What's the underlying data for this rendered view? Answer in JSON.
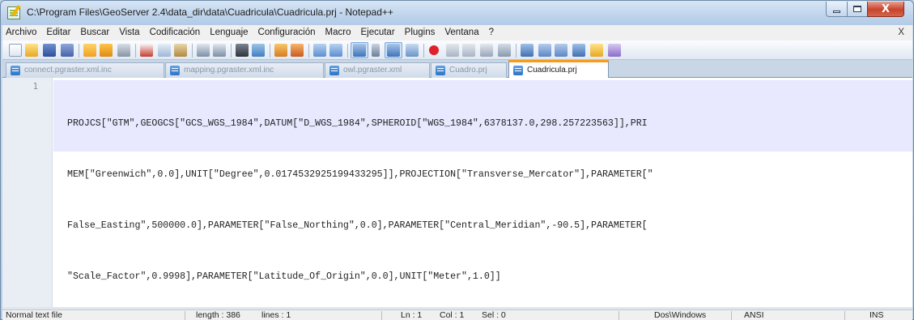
{
  "window": {
    "title": "C:\\Program Files\\GeoServer 2.4\\data_dir\\data\\Cuadricula\\Cuadricula.prj - Notepad++",
    "close_glyph": "X"
  },
  "menu": {
    "items": [
      "Archivo",
      "Editar",
      "Buscar",
      "Vista",
      "Codificación",
      "Lenguaje",
      "Configuración",
      "Macro",
      "Ejecutar",
      "Plugins",
      "Ventana",
      "?"
    ],
    "close_label": "X"
  },
  "toolbar": {
    "icons": [
      "new-file-icon",
      "open-file-icon",
      "save-icon",
      "save-all-icon",
      "close-icon",
      "close-all-icon",
      "print-icon",
      "cut-icon",
      "copy-icon",
      "paste-icon",
      "undo-icon",
      "redo-icon",
      "find-icon",
      "replace-icon",
      "zoom-in-icon",
      "zoom-out-icon",
      "sync-vertical-icon",
      "sync-horizontal-icon",
      "word-wrap-icon",
      "show-all-chars-icon",
      "indent-guide-icon",
      "doc-map-icon",
      "record-macro-icon",
      "stop-record-icon",
      "play-macro-icon",
      "run-macro-multiple-icon",
      "save-macro-icon",
      "spellcheck-icon",
      "nav-up-icon",
      "nav-down-icon",
      "plugin-icon",
      "folder-icon",
      "spell-icon"
    ]
  },
  "tabs": [
    {
      "label": "connect.pgraster.xml.inc",
      "active": false
    },
    {
      "label": "mapping.pgraster.xml.inc",
      "active": false
    },
    {
      "label": "owl.pgraster.xml",
      "active": false
    },
    {
      "label": "Cuadro.prj",
      "active": false
    },
    {
      "label": "Cuadricula.prj",
      "active": true
    }
  ],
  "editor": {
    "line_number": "1",
    "lines": [
      "PROJCS[\"GTM\",GEOGCS[\"GCS_WGS_1984\",DATUM[\"D_WGS_1984\",SPHEROID[\"WGS_1984\",6378137.0,298.257223563]],PRI",
      "MEM[\"Greenwich\",0.0],UNIT[\"Degree\",0.0174532925199433295]],PROJECTION[\"Transverse_Mercator\"],PARAMETER[\"",
      "False_Easting\",500000.0],PARAMETER[\"False_Northing\",0.0],PARAMETER[\"Central_Meridian\",-90.5],PARAMETER[",
      "\"Scale_Factor\",0.9998],PARAMETER[\"Latitude_Of_Origin\",0.0],UNIT[\"Meter\",1.0]]"
    ]
  },
  "status": {
    "file_type": "Normal text file",
    "length": "length : 386",
    "lines": "lines : 1",
    "ln": "Ln : 1",
    "col": "Col : 1",
    "sel": "Sel : 0",
    "eol": "Dos\\Windows",
    "encoding": "ANSI",
    "mode": "INS"
  },
  "colors": {
    "active_tab_accent": "#fa9a1a",
    "current_line": "#e8e8ff",
    "close_button": "#c7432b"
  }
}
